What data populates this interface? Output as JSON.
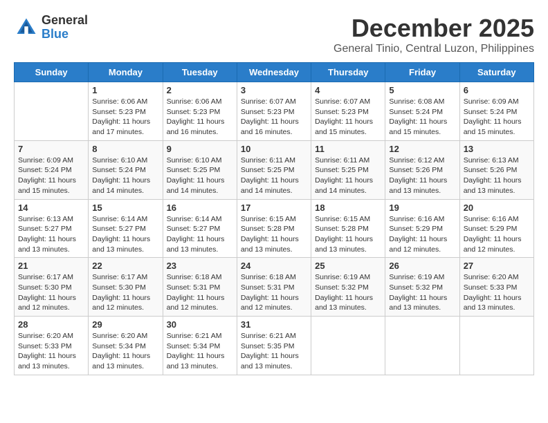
{
  "header": {
    "logo_general": "General",
    "logo_blue": "Blue",
    "month_title": "December 2025",
    "subtitle": "General Tinio, Central Luzon, Philippines"
  },
  "weekdays": [
    "Sunday",
    "Monday",
    "Tuesday",
    "Wednesday",
    "Thursday",
    "Friday",
    "Saturday"
  ],
  "weeks": [
    [
      {
        "day": "",
        "info": ""
      },
      {
        "day": "1",
        "info": "Sunrise: 6:06 AM\nSunset: 5:23 PM\nDaylight: 11 hours\nand 17 minutes."
      },
      {
        "day": "2",
        "info": "Sunrise: 6:06 AM\nSunset: 5:23 PM\nDaylight: 11 hours\nand 16 minutes."
      },
      {
        "day": "3",
        "info": "Sunrise: 6:07 AM\nSunset: 5:23 PM\nDaylight: 11 hours\nand 16 minutes."
      },
      {
        "day": "4",
        "info": "Sunrise: 6:07 AM\nSunset: 5:23 PM\nDaylight: 11 hours\nand 15 minutes."
      },
      {
        "day": "5",
        "info": "Sunrise: 6:08 AM\nSunset: 5:24 PM\nDaylight: 11 hours\nand 15 minutes."
      },
      {
        "day": "6",
        "info": "Sunrise: 6:09 AM\nSunset: 5:24 PM\nDaylight: 11 hours\nand 15 minutes."
      }
    ],
    [
      {
        "day": "7",
        "info": "Sunrise: 6:09 AM\nSunset: 5:24 PM\nDaylight: 11 hours\nand 15 minutes."
      },
      {
        "day": "8",
        "info": "Sunrise: 6:10 AM\nSunset: 5:24 PM\nDaylight: 11 hours\nand 14 minutes."
      },
      {
        "day": "9",
        "info": "Sunrise: 6:10 AM\nSunset: 5:25 PM\nDaylight: 11 hours\nand 14 minutes."
      },
      {
        "day": "10",
        "info": "Sunrise: 6:11 AM\nSunset: 5:25 PM\nDaylight: 11 hours\nand 14 minutes."
      },
      {
        "day": "11",
        "info": "Sunrise: 6:11 AM\nSunset: 5:25 PM\nDaylight: 11 hours\nand 14 minutes."
      },
      {
        "day": "12",
        "info": "Sunrise: 6:12 AM\nSunset: 5:26 PM\nDaylight: 11 hours\nand 13 minutes."
      },
      {
        "day": "13",
        "info": "Sunrise: 6:13 AM\nSunset: 5:26 PM\nDaylight: 11 hours\nand 13 minutes."
      }
    ],
    [
      {
        "day": "14",
        "info": "Sunrise: 6:13 AM\nSunset: 5:27 PM\nDaylight: 11 hours\nand 13 minutes."
      },
      {
        "day": "15",
        "info": "Sunrise: 6:14 AM\nSunset: 5:27 PM\nDaylight: 11 hours\nand 13 minutes."
      },
      {
        "day": "16",
        "info": "Sunrise: 6:14 AM\nSunset: 5:27 PM\nDaylight: 11 hours\nand 13 minutes."
      },
      {
        "day": "17",
        "info": "Sunrise: 6:15 AM\nSunset: 5:28 PM\nDaylight: 11 hours\nand 13 minutes."
      },
      {
        "day": "18",
        "info": "Sunrise: 6:15 AM\nSunset: 5:28 PM\nDaylight: 11 hours\nand 13 minutes."
      },
      {
        "day": "19",
        "info": "Sunrise: 6:16 AM\nSunset: 5:29 PM\nDaylight: 11 hours\nand 12 minutes."
      },
      {
        "day": "20",
        "info": "Sunrise: 6:16 AM\nSunset: 5:29 PM\nDaylight: 11 hours\nand 12 minutes."
      }
    ],
    [
      {
        "day": "21",
        "info": "Sunrise: 6:17 AM\nSunset: 5:30 PM\nDaylight: 11 hours\nand 12 minutes."
      },
      {
        "day": "22",
        "info": "Sunrise: 6:17 AM\nSunset: 5:30 PM\nDaylight: 11 hours\nand 12 minutes."
      },
      {
        "day": "23",
        "info": "Sunrise: 6:18 AM\nSunset: 5:31 PM\nDaylight: 11 hours\nand 12 minutes."
      },
      {
        "day": "24",
        "info": "Sunrise: 6:18 AM\nSunset: 5:31 PM\nDaylight: 11 hours\nand 12 minutes."
      },
      {
        "day": "25",
        "info": "Sunrise: 6:19 AM\nSunset: 5:32 PM\nDaylight: 11 hours\nand 13 minutes."
      },
      {
        "day": "26",
        "info": "Sunrise: 6:19 AM\nSunset: 5:32 PM\nDaylight: 11 hours\nand 13 minutes."
      },
      {
        "day": "27",
        "info": "Sunrise: 6:20 AM\nSunset: 5:33 PM\nDaylight: 11 hours\nand 13 minutes."
      }
    ],
    [
      {
        "day": "28",
        "info": "Sunrise: 6:20 AM\nSunset: 5:33 PM\nDaylight: 11 hours\nand 13 minutes."
      },
      {
        "day": "29",
        "info": "Sunrise: 6:20 AM\nSunset: 5:34 PM\nDaylight: 11 hours\nand 13 minutes."
      },
      {
        "day": "30",
        "info": "Sunrise: 6:21 AM\nSunset: 5:34 PM\nDaylight: 11 hours\nand 13 minutes."
      },
      {
        "day": "31",
        "info": "Sunrise: 6:21 AM\nSunset: 5:35 PM\nDaylight: 11 hours\nand 13 minutes."
      },
      {
        "day": "",
        "info": ""
      },
      {
        "day": "",
        "info": ""
      },
      {
        "day": "",
        "info": ""
      }
    ]
  ]
}
